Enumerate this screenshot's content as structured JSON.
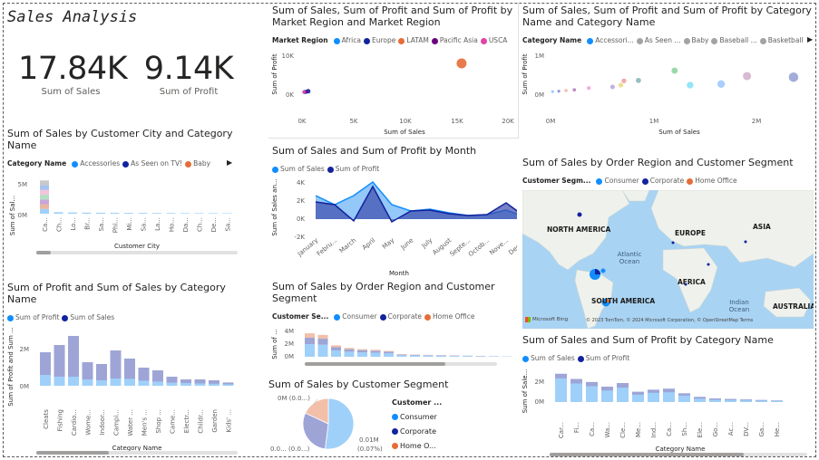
{
  "dashboard": {
    "title": "Sales Analysis",
    "kpis": [
      {
        "value": "17.84K",
        "label": "Sum of Sales"
      },
      {
        "value": "9.14K",
        "label": "Sum of Profit"
      }
    ]
  },
  "colors": {
    "sales": "#118dff",
    "profit": "#12239e",
    "light_sales": "#9fd0f9",
    "light_profit": "#9ea5d6",
    "home_office": "#e66c37",
    "pacific_asia": "#6b007b",
    "usca": "#e044a7",
    "gray": "#a3a3a3"
  },
  "scatter_region": {
    "title": "Sum of Sales, Sum of Profit and Sum of Profit by Market Region and Market Region",
    "legend_title": "Market Region",
    "legend": [
      "Africa",
      "Europe",
      "LATAM",
      "Pacific Asia",
      "USCA"
    ],
    "y_ticks": [
      "10K",
      "0K"
    ],
    "x_ticks": [
      "0K",
      "5K",
      "10K",
      "15K",
      "20K"
    ],
    "ylabel": "Sum of Profit",
    "xlabel": "Sum of Sales"
  },
  "scatter_category": {
    "title": "Sum of Sales, Sum of Profit and Sum of Profit by Category Name and Category Name",
    "legend_title": "Category Name",
    "legend": [
      "Accessori...",
      "As Seen ...",
      "Baby",
      "Baseball ...",
      "Basketball"
    ],
    "y_ticks": [
      "1M",
      "0M"
    ],
    "x_ticks": [
      "0M",
      "1M",
      "2M"
    ],
    "ylabel": "Sum of Profit",
    "xlabel": "Sum of Sales"
  },
  "city_chart": {
    "title": "Sum of Sales by Customer City and Category Name",
    "legend_title": "Category Name",
    "legend": [
      "Accessories",
      "As Seen on  TV!",
      "Baby"
    ],
    "y_ticks": [
      "5M",
      "0M"
    ],
    "ylabel": "Sum of Sal...",
    "xlabel": "Customer City",
    "categories": [
      "Ca...",
      "Ch...",
      "Lo...",
      "Br...",
      "Sa...",
      "Phi...",
      "Mi...",
      "Sa...",
      "La...",
      "Ho...",
      "Da...",
      "Ch...",
      "De...",
      "Sa..."
    ]
  },
  "month_chart": {
    "title": "Sum of Sales and Sum of Profit by Month",
    "legend": [
      "Sum of Sales",
      "Sum of Profit"
    ],
    "y_ticks": [
      "4K",
      "2K",
      "0K",
      "-2K"
    ],
    "ylabel": "Sum of Sales an...",
    "xlabel": "Month",
    "months": [
      "January",
      "Febru...",
      "March",
      "April",
      "May",
      "June",
      "July",
      "August",
      "Septe...",
      "Octob...",
      "Nove...",
      "Dece..."
    ]
  },
  "map_chart": {
    "title": "Sum of Sales by Order Region and Customer Segment",
    "legend_title": "Customer Segm...",
    "legend": [
      "Consumer",
      "Corporate",
      "Home Office"
    ],
    "labels": [
      "NORTH AMERICA",
      "EUROPE",
      "ASIA",
      "AFRICA",
      "SOUTH AMERICA",
      "AUSTRALIA"
    ],
    "oceans": [
      "Atlantic Ocean",
      "Indian Ocean"
    ],
    "bing": "Microsoft Bing",
    "copyright": "© 2023 TomTom, © 2024 Microsoft Corporation, © OpenStreetMap  Terms"
  },
  "profit_category_chart": {
    "title": "Sum of Profit and Sum of Sales by Category Name",
    "legend": [
      "Sum of Profit",
      "Sum of Sales"
    ],
    "y_ticks": [
      "2M",
      "0M"
    ],
    "ylabel": "Sum of Profit and Sum ...",
    "xlabel": "Category Name",
    "categories": [
      "Cleats",
      "Fishing",
      "Cardio...",
      "Wome...",
      "Indoor...",
      "Campi...",
      "Water ...",
      "Men's ...",
      "Shop ...",
      "Came...",
      "Electr...",
      "Childr...",
      "Garden",
      "Kids' ..."
    ]
  },
  "region_segment_chart": {
    "title": "Sum of Sales by Order Region and Customer Segment",
    "legend_title": "Customer Se...",
    "legend": [
      "Consumer",
      "Corporate",
      "Home Office"
    ],
    "y_ticks": [
      "4M",
      "2M",
      "0M"
    ],
    "ylabel": "Sum of ..."
  },
  "pie_chart": {
    "title": "Sum of Sales by Customer Segment",
    "legend_title": "Customer ...",
    "legend": [
      "Consumer",
      "Corporate",
      "Home O..."
    ],
    "label_top": "0M (0.0...)",
    "label_left": "0.0... (0.0...)",
    "label_right_1": "0.01M",
    "label_right_2": "(0.07%)"
  },
  "sales_category_chart": {
    "title": "Sum of Sales and Sum of Profit by Category Name",
    "legend": [
      "Sum of Sales",
      "Sum of Profit"
    ],
    "y_ticks": [
      "2M",
      "0M"
    ],
    "ylabel": "Sum of Sale...",
    "xlabel": "Category Name",
    "categories": [
      "Car...",
      "Fi...",
      "Ca...",
      "Wa...",
      "Cle...",
      "Me...",
      "Ind...",
      "Ca...",
      "Sh...",
      "Ele...",
      "Go...",
      "Ac...",
      "DV...",
      "Ga...",
      "He..."
    ]
  },
  "chart_data": [
    {
      "type": "scatter",
      "title": "Sum of Sales, Sum of Profit and Sum of Profit by Market Region and Market Region",
      "xlabel": "Sum of Sales",
      "ylabel": "Sum of Profit",
      "xlim": [
        0,
        20000
      ],
      "ylim": [
        -2000,
        12000
      ],
      "series": [
        {
          "name": "Africa",
          "x": [
            300
          ],
          "y": [
            100
          ]
        },
        {
          "name": "Europe",
          "x": [
            600
          ],
          "y": [
            300
          ]
        },
        {
          "name": "LATAM",
          "x": [
            15500
          ],
          "y": [
            8000
          ]
        },
        {
          "name": "Pacific Asia",
          "x": [
            400
          ],
          "y": [
            150
          ]
        },
        {
          "name": "USCA",
          "x": [
            200
          ],
          "y": [
            80
          ]
        }
      ]
    },
    {
      "type": "scatter",
      "title": "Sum of Sales, Sum of Profit and Sum of Profit by Category Name and Category Name",
      "xlabel": "Sum of Sales",
      "ylabel": "Sum of Profit",
      "xlim": [
        0,
        2500000
      ],
      "ylim": [
        -100000,
        1100000
      ],
      "x": [
        20000,
        80000,
        150000,
        230000,
        370000,
        600000,
        680000,
        710000,
        850000,
        1200000,
        1350000,
        1650000,
        1900000,
        2350000
      ],
      "y": [
        20000,
        30000,
        50000,
        70000,
        120000,
        150000,
        200000,
        320000,
        330000,
        600000,
        200000,
        230000,
        450000,
        420000
      ]
    },
    {
      "type": "bar",
      "title": "Sum of Sales by Customer City and Category Name",
      "xlabel": "Customer City",
      "ylabel": "Sum of Sal...",
      "categories": [
        "Ca...",
        "Ch...",
        "Lo...",
        "Br...",
        "Sa...",
        "Phi...",
        "Mi...",
        "Sa...",
        "La...",
        "Ho...",
        "Da...",
        "Ch...",
        "De...",
        "Sa..."
      ],
      "values": [
        5500000,
        250000,
        200000,
        180000,
        160000,
        150000,
        140000,
        130000,
        120000,
        110000,
        100000,
        95000,
        90000,
        85000
      ],
      "ylim": [
        0,
        6000000
      ]
    },
    {
      "type": "area",
      "title": "Sum of Sales and Sum of Profit by Month",
      "xlabel": "Month",
      "ylabel": "Sum of Sales an...",
      "categories": [
        "January",
        "Febru...",
        "March",
        "April",
        "May",
        "June",
        "July",
        "August",
        "Septe...",
        "Octob...",
        "Nove...",
        "Dece..."
      ],
      "series": [
        {
          "name": "Sum of Sales",
          "values": [
            2600,
            1600,
            2600,
            4100,
            1600,
            900,
            1100,
            700,
            400,
            500,
            1000,
            250
          ]
        },
        {
          "name": "Sum of Profit",
          "values": [
            1900,
            1600,
            -200,
            3600,
            -300,
            900,
            1000,
            600,
            400,
            500,
            1800,
            250
          ]
        }
      ],
      "ylim": [
        -2500,
        4500
      ]
    },
    {
      "type": "bar",
      "title": "Sum of Profit and Sum of Sales by Category Name",
      "xlabel": "Category Name",
      "ylabel": "Sum of Profit and Sum ...",
      "categories": [
        "Cleats",
        "Fishing",
        "Cardio...",
        "Wome...",
        "Indoor...",
        "Campi...",
        "Water ...",
        "Men's ...",
        "Shop ...",
        "Came...",
        "Electr...",
        "Childr...",
        "Garden",
        "Kids' ..."
      ],
      "series": [
        {
          "name": "Sum of Profit",
          "values": [
            600000,
            500000,
            500000,
            350000,
            300000,
            400000,
            380000,
            280000,
            230000,
            170000,
            150000,
            130000,
            110000,
            80000
          ]
        },
        {
          "name": "Sum of Sales",
          "values": [
            1850000,
            2250000,
            2750000,
            1300000,
            1200000,
            1950000,
            1500000,
            1000000,
            850000,
            500000,
            350000,
            350000,
            300000,
            180000
          ]
        }
      ],
      "ylim": [
        0,
        3000000
      ]
    },
    {
      "type": "bar",
      "title": "Sum of Sales by Order Region and Customer Segment",
      "ylabel": "Sum of ...",
      "series": [
        {
          "name": "Consumer",
          "values": [
            2000000,
            1900000,
            1000000,
            800000,
            700000,
            650000,
            550000,
            250000,
            220000,
            180000,
            150000,
            130000,
            110000,
            80000,
            60000,
            40000
          ]
        },
        {
          "name": "Corporate",
          "values": [
            1000000,
            950000,
            500000,
            400000,
            350000,
            300000,
            250000,
            100000,
            90000,
            80000,
            70000,
            60000,
            50000,
            40000,
            30000,
            20000
          ]
        },
        {
          "name": "Home Office",
          "values": [
            700000,
            600000,
            300000,
            200000,
            150000,
            150000,
            120000,
            60000,
            50000,
            40000,
            30000,
            30000,
            20000,
            20000,
            10000,
            10000
          ]
        }
      ],
      "ylim": [
        0,
        4000000
      ]
    },
    {
      "type": "pie",
      "title": "Sum of Sales by Customer Segment",
      "categories": [
        "Consumer",
        "Corporate",
        "Home Office"
      ],
      "values": [
        0.52,
        0.3,
        0.18
      ]
    },
    {
      "type": "bar",
      "title": "Sum of Sales and Sum of Profit by Category Name",
      "xlabel": "Category Name",
      "ylabel": "Sum of Sale...",
      "categories": [
        "Car...",
        "Fi...",
        "Ca...",
        "Wa...",
        "Cle...",
        "Me...",
        "Ind...",
        "Ca...",
        "Sh...",
        "Ele...",
        "Go...",
        "Ac...",
        "DV...",
        "Ga...",
        "He..."
      ],
      "series": [
        {
          "name": "Sum of Sales",
          "values": [
            2750000,
            2250000,
            1950000,
            1500000,
            1850000,
            1000000,
            1200000,
            1300000,
            850000,
            500000,
            350000,
            300000,
            250000,
            200000,
            150000
          ]
        },
        {
          "name": "Sum of Profit",
          "values": [
            500000,
            500000,
            400000,
            380000,
            600000,
            280000,
            300000,
            350000,
            230000,
            170000,
            130000,
            110000,
            90000,
            70000,
            50000
          ]
        }
      ],
      "ylim": [
        0,
        3000000
      ]
    }
  ]
}
